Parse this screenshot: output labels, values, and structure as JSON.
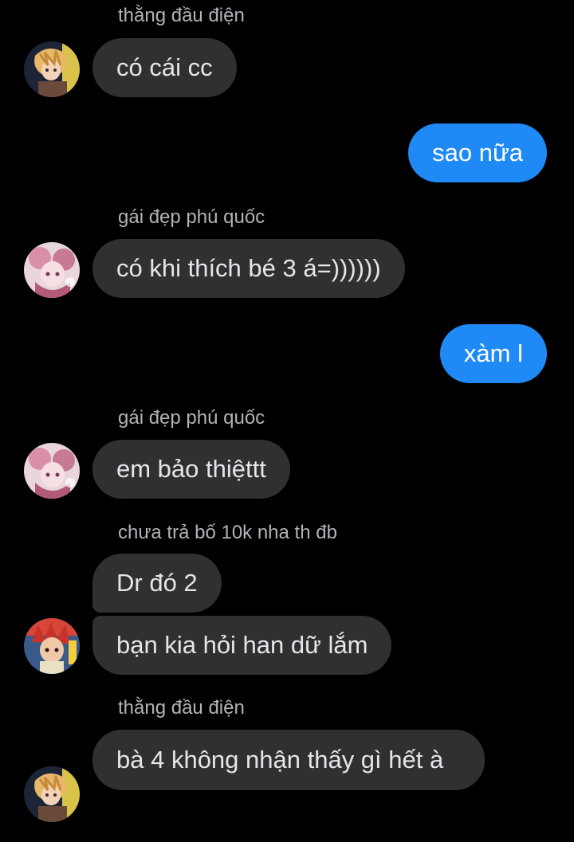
{
  "messages": [
    {
      "sender": "thằng đầu điện",
      "text": "có cái cc"
    },
    {
      "text": "sao nữa"
    },
    {
      "sender": "gái đẹp phú quốc",
      "text": "có khi thích bé 3 á=))))))"
    },
    {
      "text": "xàm l"
    },
    {
      "sender": "gái đẹp phú quốc",
      "text": "em bảo thiệttt"
    },
    {
      "sender": "chưa trả bố 10k nha th đb",
      "text": "Dr đó 2"
    },
    {
      "text": "bạn kia hỏi han dữ lắm"
    },
    {
      "sender": "thằng đầu điện",
      "text": "bà 4 không nhận thấy gì hết à"
    }
  ],
  "colors": {
    "background": "#000000",
    "incoming_bubble": "#303030",
    "outgoing_bubble": "#1f8af5",
    "sender_name": "#b0b3b8"
  },
  "avatars": [
    "avatar-blonde-anime",
    "avatar-pink-anime",
    "avatar-red-hair-anime"
  ]
}
